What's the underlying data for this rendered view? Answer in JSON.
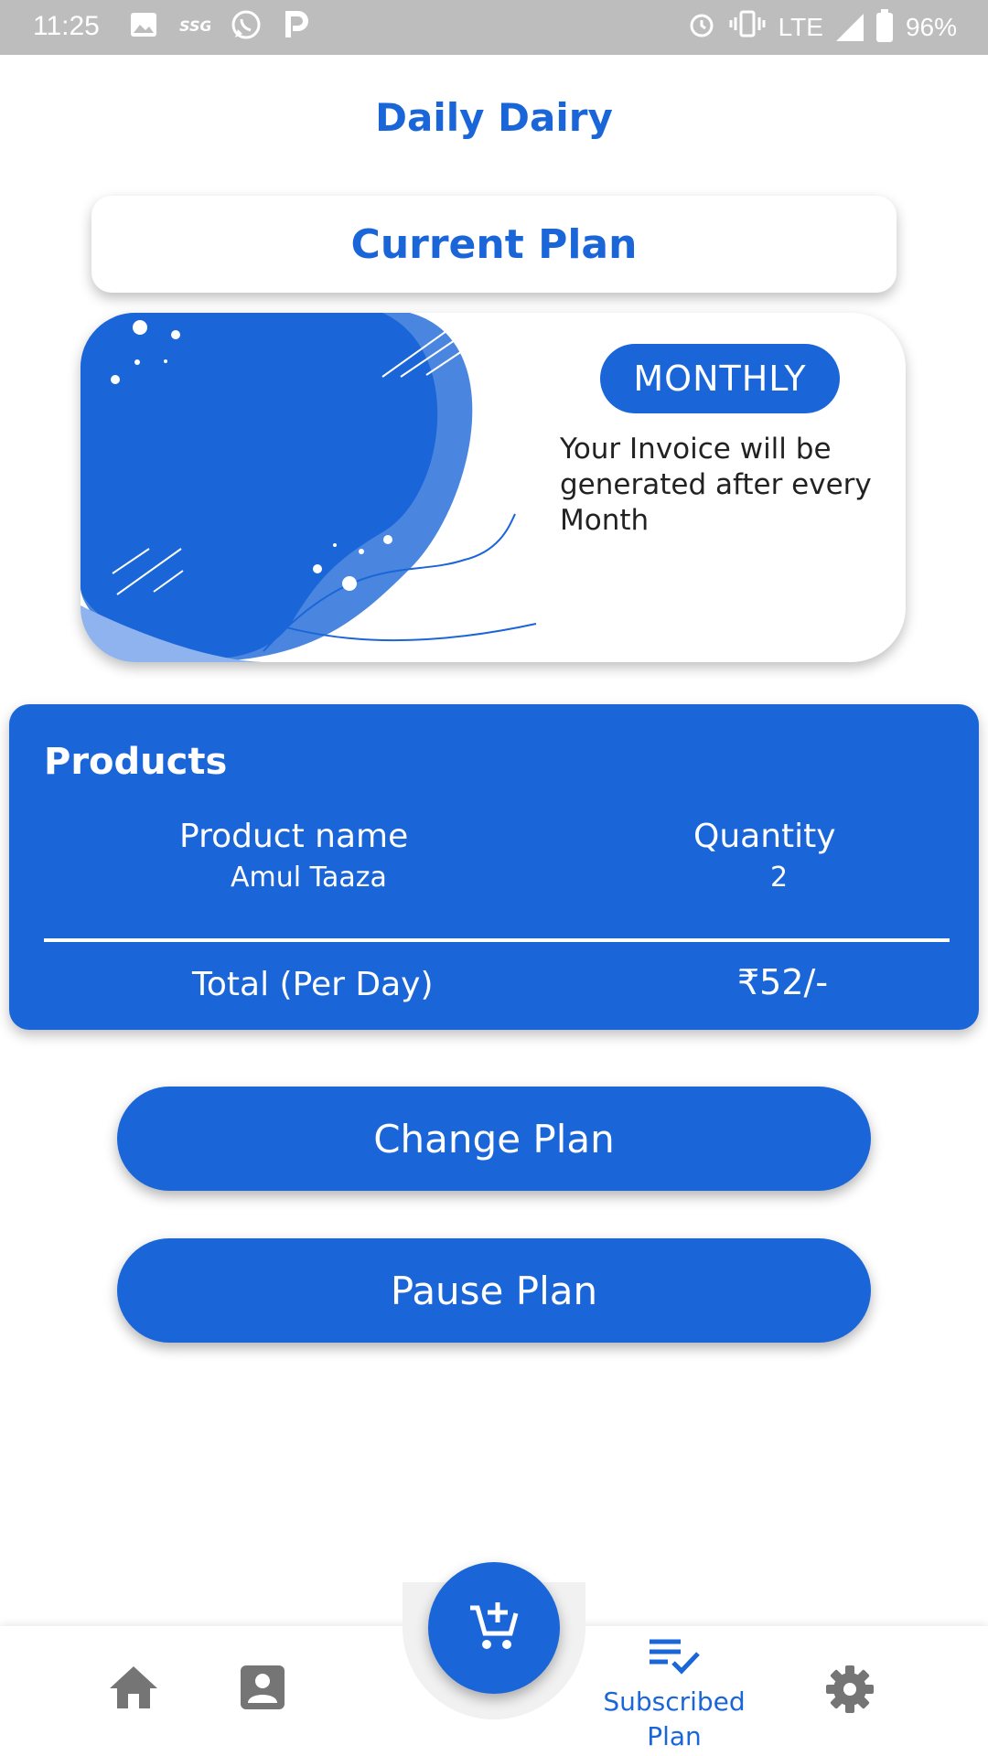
{
  "status_bar": {
    "time": "11:25",
    "network": "LTE",
    "battery": "96%",
    "notification_icons": [
      "image-icon",
      "ssg-icon",
      "whatsapp-icon",
      "p-icon"
    ],
    "system_icons": [
      "alarm-icon",
      "vibrate-icon",
      "signal-icon",
      "battery-icon"
    ]
  },
  "header": {
    "title": "Daily Dairy"
  },
  "current_plan": {
    "heading": "Current Plan",
    "badge": "MONTHLY",
    "description": "Your Invoice will be generated after every Month"
  },
  "products": {
    "title": "Products",
    "columns": {
      "name": "Product name",
      "quantity": "Quantity"
    },
    "rows": [
      {
        "name": "Amul Taaza",
        "quantity": "2"
      }
    ],
    "total_label": "Total (Per Day)",
    "total_value": "₹52/-"
  },
  "actions": {
    "change_plan": "Change Plan",
    "pause_plan": "Pause Plan"
  },
  "bottom_nav": {
    "items": [
      {
        "icon": "home-icon",
        "label": ""
      },
      {
        "icon": "profile-icon",
        "label": ""
      },
      {
        "icon": "add-to-cart-icon",
        "label": ""
      },
      {
        "icon": "subscribed-plan-icon",
        "label": "Subscribed Plan"
      },
      {
        "icon": "settings-icon",
        "label": ""
      }
    ],
    "active_color": "#1a66d9",
    "inactive_color": "#757575"
  },
  "colors": {
    "primary": "#1a66d9",
    "status_bar": "#bdbdbd"
  }
}
